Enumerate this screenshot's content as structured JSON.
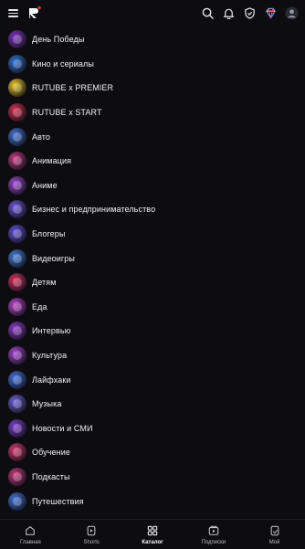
{
  "header": {
    "menu_icon": "burger-menu-icon",
    "logo_icon": "rutube-logo-icon",
    "icons": [
      "search-icon",
      "bell-icon",
      "shield-icon",
      "premium-diamond-icon",
      "avatar-icon"
    ]
  },
  "categories": [
    {
      "label": "День Победы",
      "color": "#7b2fbf"
    },
    {
      "label": "Кино и сериалы",
      "color": "#2a6fd6"
    },
    {
      "label": "RUTUBE x PREMIER",
      "color": "#e6c419"
    },
    {
      "label": "RUTUBE x START",
      "color": "#d6284a"
    },
    {
      "label": "Авто",
      "color": "#3b6fd8"
    },
    {
      "label": "Анимация",
      "color": "#c2337a"
    },
    {
      "label": "Аниме",
      "color": "#9a3fd0"
    },
    {
      "label": "Бизнес и предпринимательство",
      "color": "#6a4fe0"
    },
    {
      "label": "Блогеры",
      "color": "#5a4ed8"
    },
    {
      "label": "Видеоигры",
      "color": "#3b7bd8"
    },
    {
      "label": "Детям",
      "color": "#d8285a"
    },
    {
      "label": "Еда",
      "color": "#b83fc8"
    },
    {
      "label": "Интервью",
      "color": "#8a35c8"
    },
    {
      "label": "Культура",
      "color": "#a43fd0"
    },
    {
      "label": "Лайфхаки",
      "color": "#3a6fe0"
    },
    {
      "label": "Музыка",
      "color": "#6a5ad8"
    },
    {
      "label": "Новости и СМИ",
      "color": "#7a3ad0"
    },
    {
      "label": "Обучение",
      "color": "#d8336a"
    },
    {
      "label": "Подкасты",
      "color": "#c8337a"
    },
    {
      "label": "Путешествия",
      "color": "#3b6fd8"
    }
  ],
  "bottom_nav": [
    {
      "label": "Главная",
      "icon": "home-icon",
      "active": false
    },
    {
      "label": "Shorts",
      "icon": "shorts-icon",
      "active": false
    },
    {
      "label": "Каталог",
      "icon": "catalog-grid-icon",
      "active": true
    },
    {
      "label": "Подписки",
      "icon": "subscriptions-icon",
      "active": false
    },
    {
      "label": "Мой",
      "icon": "my-videos-icon",
      "active": false
    }
  ],
  "colors": {
    "background": "#0d0d11",
    "brand_red": "#ff1e3c",
    "text": "#f2f2f5"
  }
}
